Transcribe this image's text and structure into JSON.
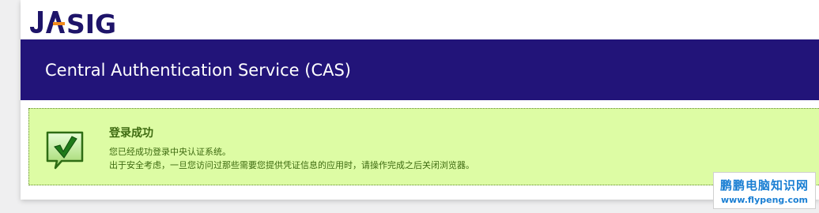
{
  "logo": {
    "text": "JA-SIG",
    "alt_text": "JASIG"
  },
  "banner": {
    "title": "Central Authentication Service (CAS)"
  },
  "message": {
    "title": "登录成功",
    "line1": "您已经成功登录中央认证系统。",
    "line2": "出于安全考虑，一旦您访问过那些需要您提供凭证信息的应用时，请操作完成之后关闭浏览器。",
    "icon": "checkmark-speech-bubble-icon"
  },
  "watermark": {
    "main": "鹏鹏电脑知识网",
    "sub": "www.flypeng.com"
  },
  "colors": {
    "banner_bg": "#221479",
    "logo_primary": "#1e1469",
    "logo_accent": "#f28a1b",
    "message_bg": "#ddfca4",
    "message_text": "#3d6a10",
    "watermark_text": "#1a7fd3"
  }
}
